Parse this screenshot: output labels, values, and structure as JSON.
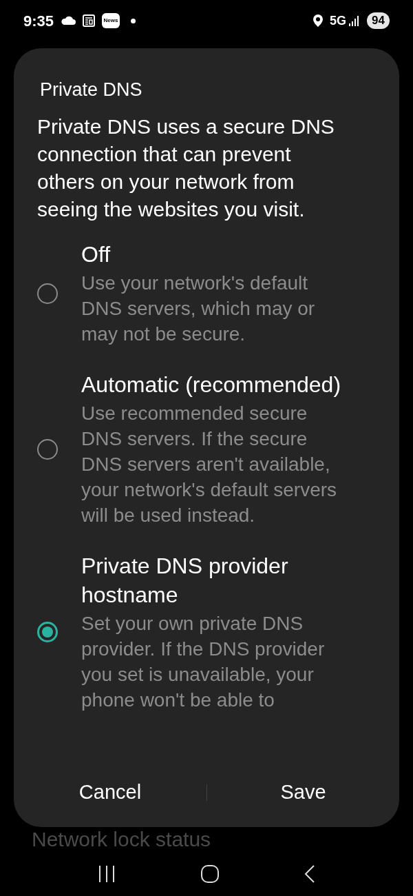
{
  "status_bar": {
    "time": "9:35",
    "news_badge": "News",
    "network": "5G",
    "battery": "94"
  },
  "dialog": {
    "title": "Private DNS",
    "description": "Private DNS uses a secure DNS connection that can prevent others on your network from seeing the websites you visit.",
    "options": [
      {
        "title": "Off",
        "description": "Use your network's default DNS servers, which may or may not be secure.",
        "selected": false
      },
      {
        "title": "Automatic (recommended)",
        "description": "Use recommended secure DNS servers. If the secure DNS servers aren't available, your network's default servers will be used instead.",
        "selected": false
      },
      {
        "title": "Private DNS provider hostname",
        "description": "Set your own private DNS provider. If the DNS provider you set is unavailable, your phone won't be able to",
        "selected": true
      }
    ],
    "buttons": [
      "Cancel",
      "Save"
    ]
  },
  "background_item": "Network lock status"
}
